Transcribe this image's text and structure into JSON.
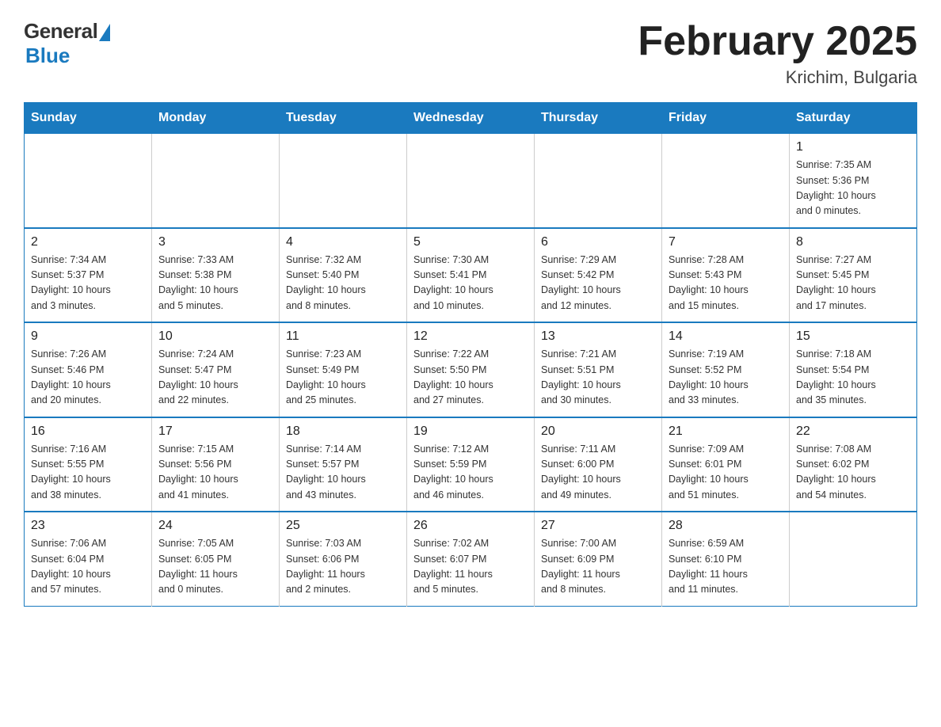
{
  "header": {
    "logo_general": "General",
    "logo_blue": "Blue",
    "title": "February 2025",
    "location": "Krichim, Bulgaria"
  },
  "weekdays": [
    "Sunday",
    "Monday",
    "Tuesday",
    "Wednesday",
    "Thursday",
    "Friday",
    "Saturday"
  ],
  "weeks": [
    [
      {
        "day": "",
        "info": ""
      },
      {
        "day": "",
        "info": ""
      },
      {
        "day": "",
        "info": ""
      },
      {
        "day": "",
        "info": ""
      },
      {
        "day": "",
        "info": ""
      },
      {
        "day": "",
        "info": ""
      },
      {
        "day": "1",
        "info": "Sunrise: 7:35 AM\nSunset: 5:36 PM\nDaylight: 10 hours\nand 0 minutes."
      }
    ],
    [
      {
        "day": "2",
        "info": "Sunrise: 7:34 AM\nSunset: 5:37 PM\nDaylight: 10 hours\nand 3 minutes."
      },
      {
        "day": "3",
        "info": "Sunrise: 7:33 AM\nSunset: 5:38 PM\nDaylight: 10 hours\nand 5 minutes."
      },
      {
        "day": "4",
        "info": "Sunrise: 7:32 AM\nSunset: 5:40 PM\nDaylight: 10 hours\nand 8 minutes."
      },
      {
        "day": "5",
        "info": "Sunrise: 7:30 AM\nSunset: 5:41 PM\nDaylight: 10 hours\nand 10 minutes."
      },
      {
        "day": "6",
        "info": "Sunrise: 7:29 AM\nSunset: 5:42 PM\nDaylight: 10 hours\nand 12 minutes."
      },
      {
        "day": "7",
        "info": "Sunrise: 7:28 AM\nSunset: 5:43 PM\nDaylight: 10 hours\nand 15 minutes."
      },
      {
        "day": "8",
        "info": "Sunrise: 7:27 AM\nSunset: 5:45 PM\nDaylight: 10 hours\nand 17 minutes."
      }
    ],
    [
      {
        "day": "9",
        "info": "Sunrise: 7:26 AM\nSunset: 5:46 PM\nDaylight: 10 hours\nand 20 minutes."
      },
      {
        "day": "10",
        "info": "Sunrise: 7:24 AM\nSunset: 5:47 PM\nDaylight: 10 hours\nand 22 minutes."
      },
      {
        "day": "11",
        "info": "Sunrise: 7:23 AM\nSunset: 5:49 PM\nDaylight: 10 hours\nand 25 minutes."
      },
      {
        "day": "12",
        "info": "Sunrise: 7:22 AM\nSunset: 5:50 PM\nDaylight: 10 hours\nand 27 minutes."
      },
      {
        "day": "13",
        "info": "Sunrise: 7:21 AM\nSunset: 5:51 PM\nDaylight: 10 hours\nand 30 minutes."
      },
      {
        "day": "14",
        "info": "Sunrise: 7:19 AM\nSunset: 5:52 PM\nDaylight: 10 hours\nand 33 minutes."
      },
      {
        "day": "15",
        "info": "Sunrise: 7:18 AM\nSunset: 5:54 PM\nDaylight: 10 hours\nand 35 minutes."
      }
    ],
    [
      {
        "day": "16",
        "info": "Sunrise: 7:16 AM\nSunset: 5:55 PM\nDaylight: 10 hours\nand 38 minutes."
      },
      {
        "day": "17",
        "info": "Sunrise: 7:15 AM\nSunset: 5:56 PM\nDaylight: 10 hours\nand 41 minutes."
      },
      {
        "day": "18",
        "info": "Sunrise: 7:14 AM\nSunset: 5:57 PM\nDaylight: 10 hours\nand 43 minutes."
      },
      {
        "day": "19",
        "info": "Sunrise: 7:12 AM\nSunset: 5:59 PM\nDaylight: 10 hours\nand 46 minutes."
      },
      {
        "day": "20",
        "info": "Sunrise: 7:11 AM\nSunset: 6:00 PM\nDaylight: 10 hours\nand 49 minutes."
      },
      {
        "day": "21",
        "info": "Sunrise: 7:09 AM\nSunset: 6:01 PM\nDaylight: 10 hours\nand 51 minutes."
      },
      {
        "day": "22",
        "info": "Sunrise: 7:08 AM\nSunset: 6:02 PM\nDaylight: 10 hours\nand 54 minutes."
      }
    ],
    [
      {
        "day": "23",
        "info": "Sunrise: 7:06 AM\nSunset: 6:04 PM\nDaylight: 10 hours\nand 57 minutes."
      },
      {
        "day": "24",
        "info": "Sunrise: 7:05 AM\nSunset: 6:05 PM\nDaylight: 11 hours\nand 0 minutes."
      },
      {
        "day": "25",
        "info": "Sunrise: 7:03 AM\nSunset: 6:06 PM\nDaylight: 11 hours\nand 2 minutes."
      },
      {
        "day": "26",
        "info": "Sunrise: 7:02 AM\nSunset: 6:07 PM\nDaylight: 11 hours\nand 5 minutes."
      },
      {
        "day": "27",
        "info": "Sunrise: 7:00 AM\nSunset: 6:09 PM\nDaylight: 11 hours\nand 8 minutes."
      },
      {
        "day": "28",
        "info": "Sunrise: 6:59 AM\nSunset: 6:10 PM\nDaylight: 11 hours\nand 11 minutes."
      },
      {
        "day": "",
        "info": ""
      }
    ]
  ]
}
